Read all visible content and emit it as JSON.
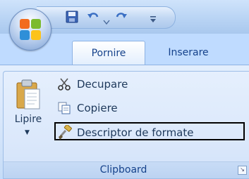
{
  "quick_access_toolbar": {
    "items": [
      {
        "icon": "save-icon"
      },
      {
        "icon": "undo-icon"
      },
      {
        "icon": "undo-dropdown-icon"
      },
      {
        "icon": "redo-icon"
      },
      {
        "icon": "customize-toolbar-icon"
      }
    ]
  },
  "office_button": {
    "icon": "office-logo-icon"
  },
  "tabs": [
    {
      "label": "Pornire",
      "active": true
    },
    {
      "label": "Inserare",
      "active": false
    }
  ],
  "clipboard_group": {
    "label": "Clipboard",
    "paste": {
      "label": "Lipire",
      "icon": "paste-icon"
    },
    "commands": [
      {
        "label": "Decupare",
        "icon": "scissors-icon"
      },
      {
        "label": "Copiere",
        "icon": "copy-icon"
      },
      {
        "label": "Descriptor de formate",
        "icon": "format-painter-icon",
        "highlighted": true
      }
    ]
  },
  "colors": {
    "ribbon_text": "#15428b",
    "highlight_border": "#000000"
  }
}
